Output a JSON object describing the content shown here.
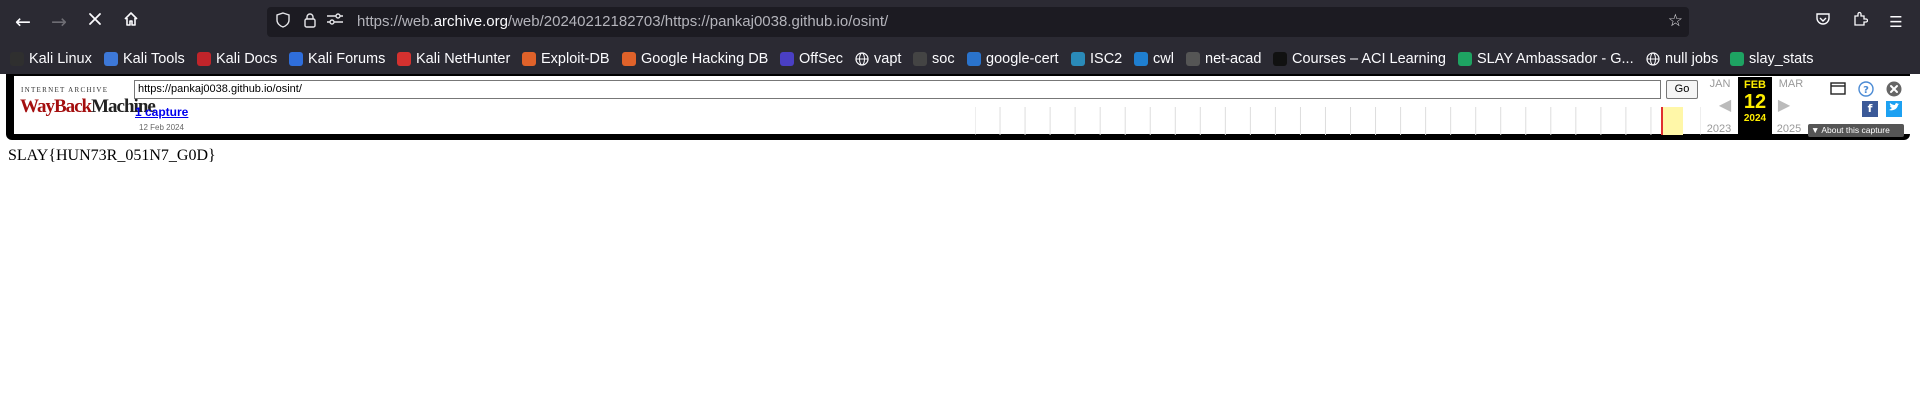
{
  "browser": {
    "url_prefix": "https://web.",
    "url_domain": "archive.org",
    "url_suffix": "/web/20240212182703/https://pankaj0038.github.io/osint/"
  },
  "bookmarks": [
    {
      "label": "Kali Linux",
      "icon": "kali-dragon-icon",
      "color": "#2f2f2f"
    },
    {
      "label": "Kali Tools",
      "icon": "kali-tools-icon",
      "color": "#3d78d8"
    },
    {
      "label": "Kali Docs",
      "icon": "kali-docs-icon",
      "color": "#c0242a"
    },
    {
      "label": "Kali Forums",
      "icon": "kali-forums-icon",
      "color": "#2f6edb"
    },
    {
      "label": "Kali NetHunter",
      "icon": "nethunter-icon",
      "color": "#d4312f"
    },
    {
      "label": "Exploit-DB",
      "icon": "exploit-db-icon",
      "color": "#e0622a"
    },
    {
      "label": "Google Hacking DB",
      "icon": "ghdb-icon",
      "color": "#e0622a"
    },
    {
      "label": "OffSec",
      "icon": "offsec-icon",
      "color": "#4a3fc4"
    },
    {
      "label": "vapt",
      "icon": "globe-icon",
      "color": "transparent"
    },
    {
      "label": "soc",
      "icon": "soc-icon",
      "color": "#444"
    },
    {
      "label": "google-cert",
      "icon": "coursera-icon",
      "color": "#2a73cc"
    },
    {
      "label": "ISC2",
      "icon": "isc2-icon",
      "color": "#2a8ab8"
    },
    {
      "label": "cwl",
      "icon": "cwl-icon",
      "color": "#1f7fd0"
    },
    {
      "label": "net-acad",
      "icon": "cisco-icon",
      "color": "#555"
    },
    {
      "label": "Courses – ACI Learning",
      "icon": "aci-icon",
      "color": "#111"
    },
    {
      "label": "SLAY Ambassador - G...",
      "icon": "sheets-icon",
      "color": "#1ea362"
    },
    {
      "label": "null jobs",
      "icon": "globe-icon",
      "color": "transparent"
    },
    {
      "label": "slay_stats",
      "icon": "sheets-icon",
      "color": "#1ea362"
    }
  ],
  "wayback": {
    "logo_top": "INTERNET ARCHIVE",
    "logo_way": "WayBack",
    "logo_machine": "Machine",
    "url_value": "https://pankaj0038.github.io/osint/",
    "go_label": "Go",
    "captures_label": "1 capture",
    "capture_date": "12 Feb 2024",
    "prev_month": "JAN",
    "cur_month": "FEB",
    "cur_day": "12",
    "cur_year": "2024",
    "next_month": "MAR",
    "prev_year": "2023",
    "next_year": "2025",
    "about_label": "About this capture"
  },
  "page": {
    "text": "SLAY{HUN73R_051N7_G0D}"
  }
}
